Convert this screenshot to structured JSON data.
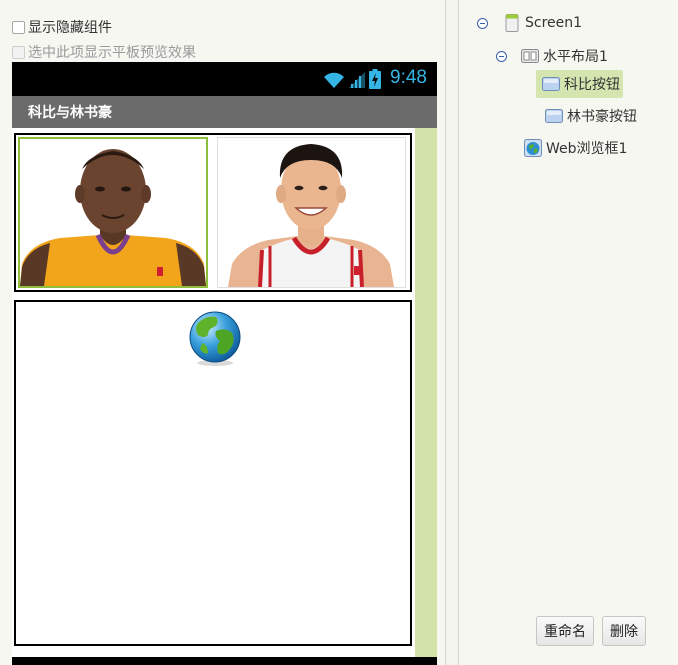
{
  "viewer": {
    "show_hidden_label": "显示隐藏组件",
    "tablet_preview_label": "选中此项显示平板预览效果"
  },
  "phone": {
    "time": "9:48",
    "title": "科比与林书豪"
  },
  "tree": {
    "screen": "Screen1",
    "horizontal_layout": "水平布局1",
    "button_kobe": "科比按钮",
    "button_lin": "林书豪按钮",
    "web_viewer": "Web浏览框1"
  },
  "actions": {
    "rename": "重命名",
    "delete": "删除"
  },
  "colors": {
    "status_accent": "#35b5e5",
    "selection": "#d5e5b0",
    "scroll_strip": "#d2e2a8"
  }
}
